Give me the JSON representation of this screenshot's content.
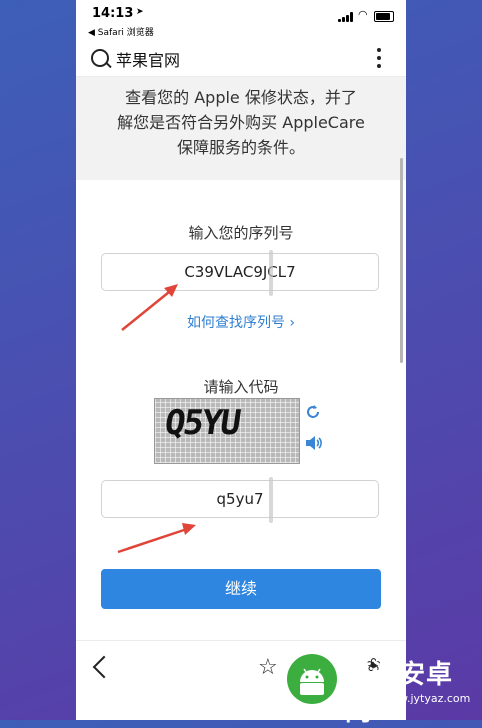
{
  "status": {
    "time": "14:13",
    "back_app": "◀ Safari 浏览器"
  },
  "browser": {
    "site_title": "苹果官网"
  },
  "banner": {
    "lines": [
      "查看您的 Apple 保修状态，并了",
      "解您是否符合另外购买 AppleCare",
      "保障服务的条件。"
    ]
  },
  "form": {
    "serial_label": "输入您的序列号",
    "serial_value": "C39VLAC9JCL7",
    "howto_link": "如何查找序列号 ›",
    "code_label": "请输入代码",
    "captcha_text": "Q5YU",
    "code_value": "q5yu7",
    "continue_label": "继续"
  },
  "toolbar": {
    "tabs_count": "1"
  },
  "watermark": {
    "title": "天源安卓网",
    "url": "www.jytyaz.com"
  },
  "colors": {
    "accent": "#2f86e0",
    "link": "#2f7fd1",
    "arrow": "#e0453a"
  }
}
